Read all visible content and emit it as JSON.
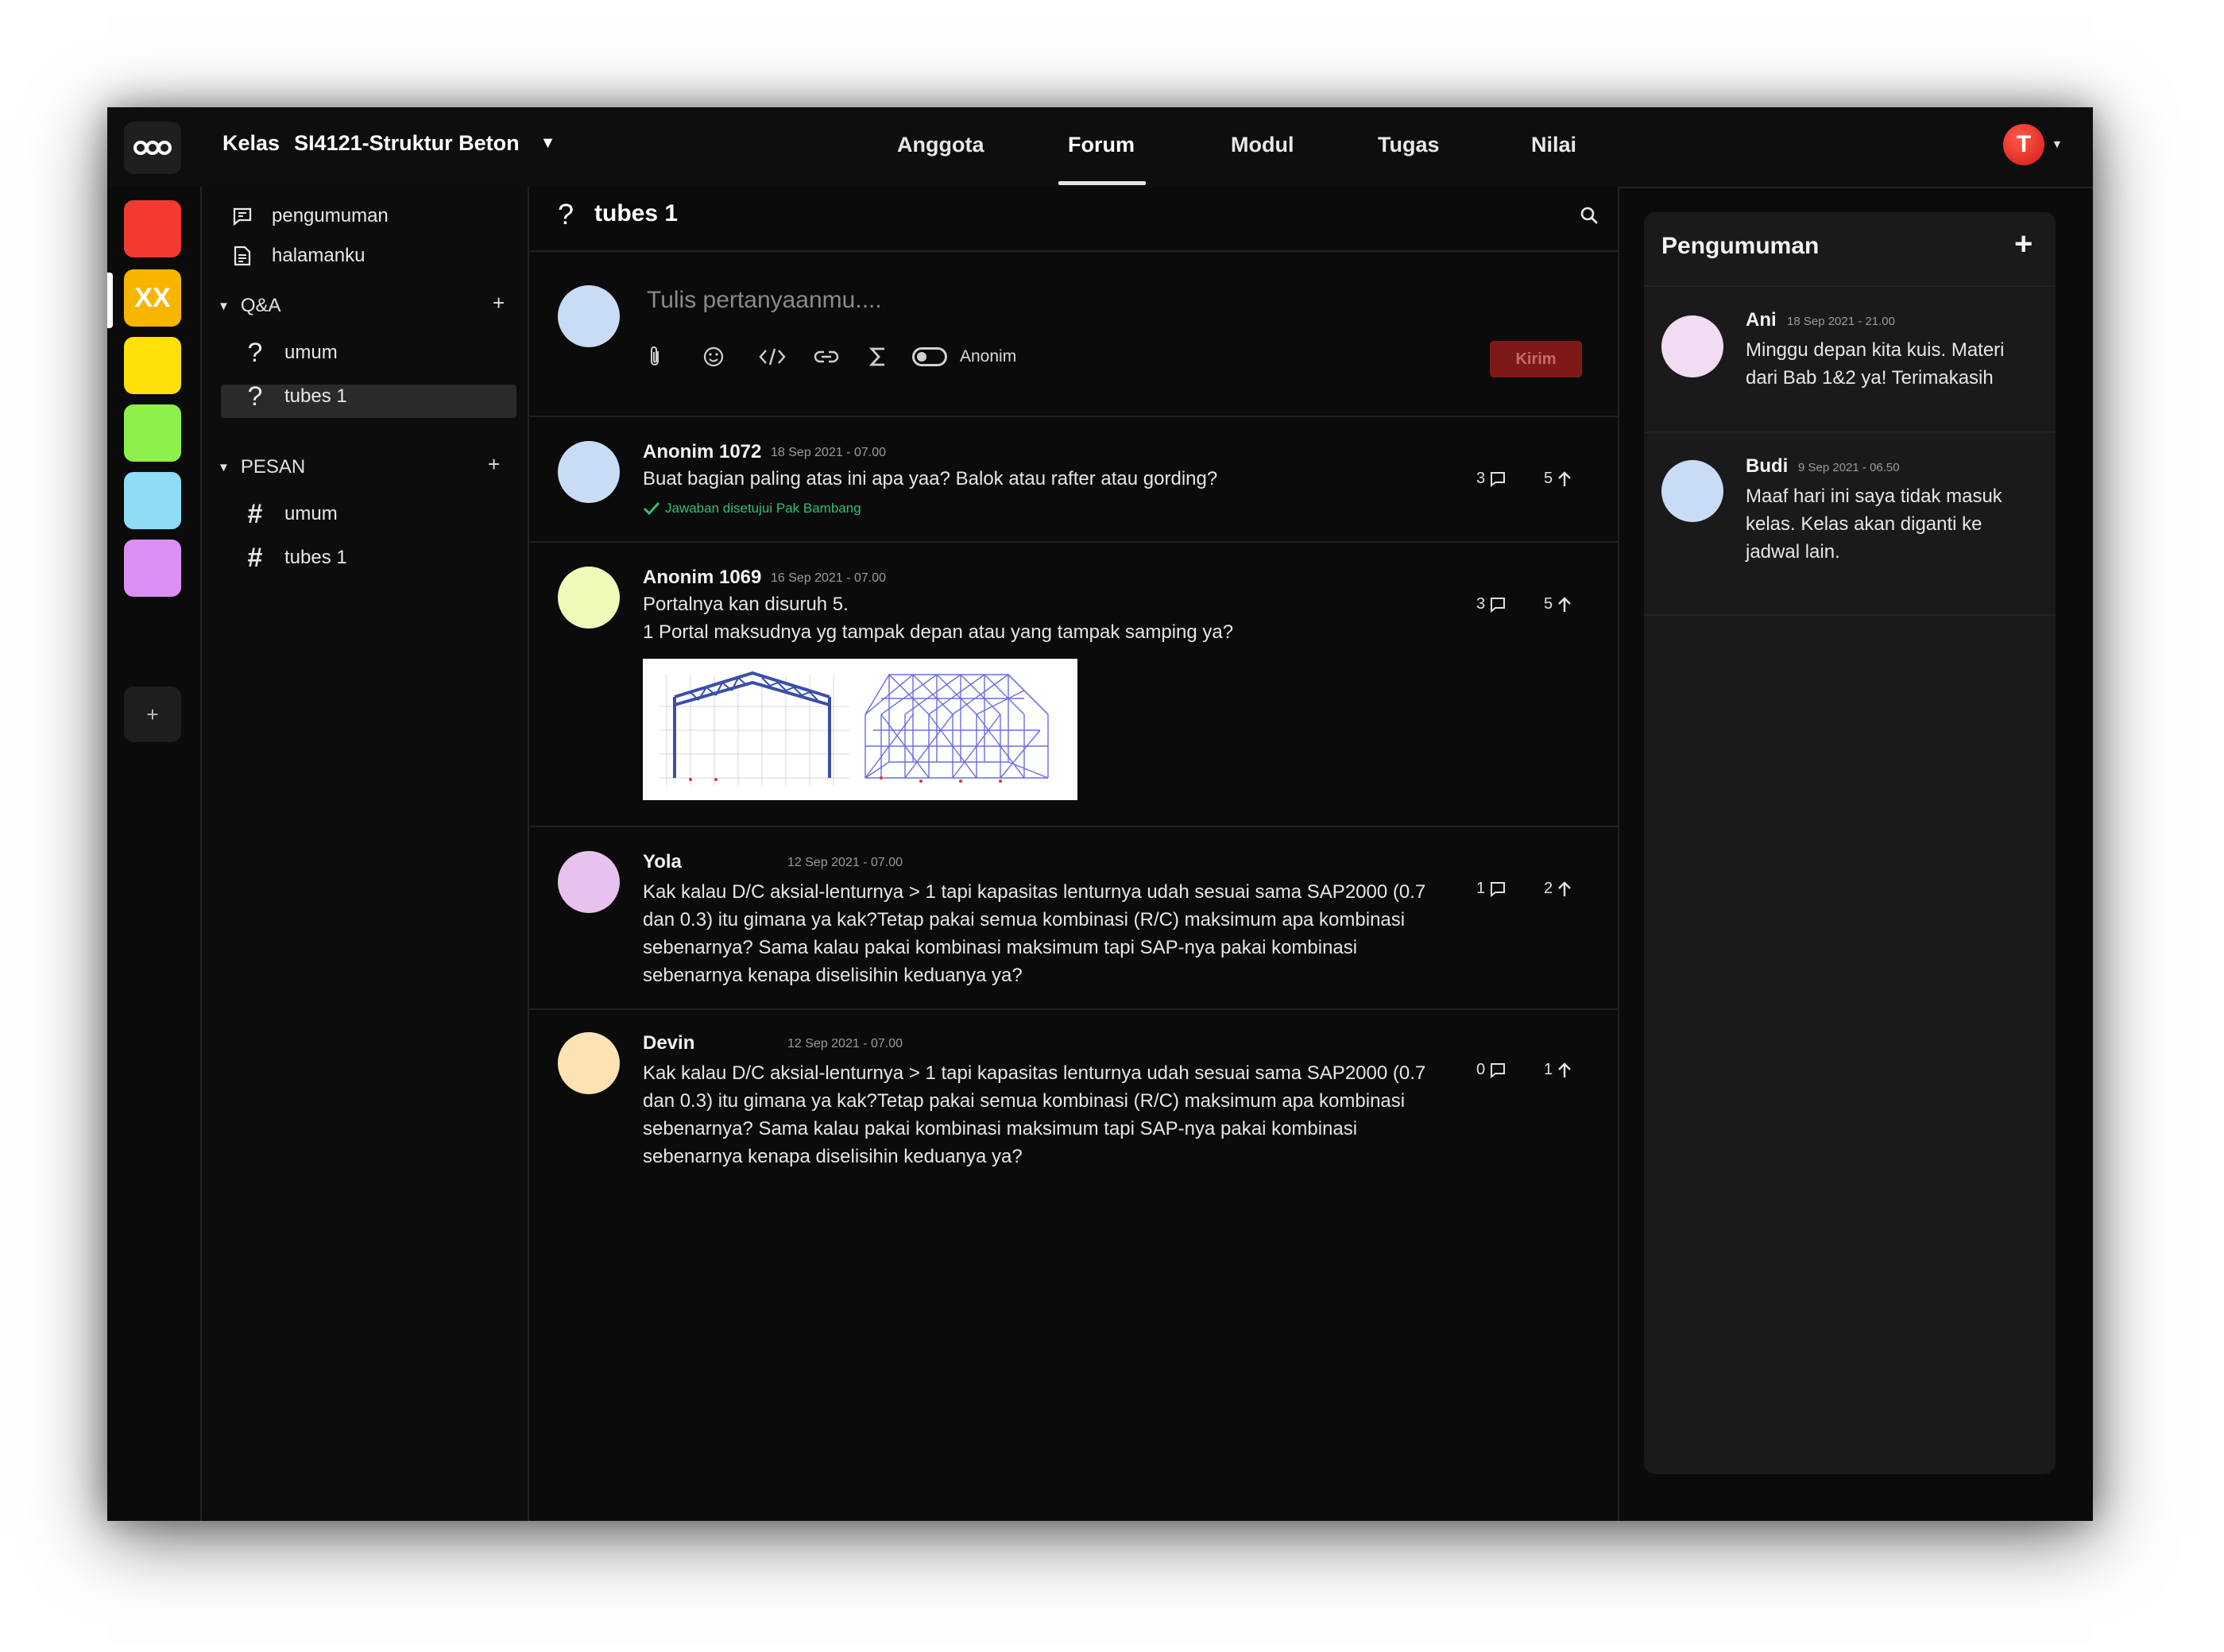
{
  "header": {
    "class_label": "Kelas",
    "class_name": "SI4121-Struktur Beton",
    "user_initial": "T",
    "nav": [
      "Anggota",
      "Forum",
      "Modul",
      "Tugas",
      "Nilai"
    ],
    "active_nav": "Forum"
  },
  "rail": {
    "tiles": [
      {
        "color": "#f23a30",
        "label": ""
      },
      {
        "color": "#f7b500",
        "label": "XX"
      },
      {
        "color": "#ffe10a",
        "label": ""
      },
      {
        "color": "#8ef04a",
        "label": ""
      },
      {
        "color": "#8fdcf7",
        "label": ""
      },
      {
        "color": "#dd90f4",
        "label": ""
      }
    ],
    "add_label": "+"
  },
  "sidebar": {
    "pengumuman": "pengumuman",
    "halamanku": "halamanku",
    "qa_section": "Q&A",
    "qa_items": [
      "umum",
      "tubes 1"
    ],
    "pesan_section": "PESAN",
    "pesan_items": [
      "umum",
      "tubes 1"
    ],
    "plus": "+"
  },
  "thread": {
    "title": "tubes 1",
    "compose_placeholder": "Tulis pertanyaanmu....",
    "anon_label": "Anonim",
    "send_label": "Kirim",
    "posts": [
      {
        "name": "Anonim 1072",
        "time": "18 Sep 2021 - 07.00",
        "body": "Buat bagian paling atas ini apa yaa? Balok atau rafter atau gording?",
        "approved": "Jawaban disetujui Pak Bambang",
        "replies": "3",
        "votes": "5",
        "avatar_color": "#c9dcf6"
      },
      {
        "name": "Anonim 1069",
        "time": "16 Sep 2021 - 07.00",
        "body": "Portalnya kan disuruh 5.\n1 Portal maksudnya yg tampak depan atau yang tampak samping ya?",
        "replies": "3",
        "votes": "5",
        "avatar_color": "#eefab8"
      },
      {
        "name": "Yola",
        "time": "12 Sep 2021 - 07.00",
        "body": "Kak kalau D/C aksial-lenturnya > 1 tapi kapasitas lenturnya udah sesuai sama SAP2000 (0.7 dan 0.3) itu gimana ya kak?Tetap pakai semua kombinasi (R/C) maksimum apa kombinasi sebenarnya? Sama kalau pakai kombinasi maksimum tapi SAP-nya pakai kombinasi sebenarnya kenapa diselisihin keduanya ya?",
        "replies": "1",
        "votes": "2",
        "avatar_color": "#e8c2ee"
      },
      {
        "name": "Devin",
        "time": "12 Sep 2021 - 07.00",
        "body": "Kak kalau D/C aksial-lenturnya > 1 tapi kapasitas lenturnya udah sesuai sama SAP2000 (0.7 dan 0.3) itu gimana ya kak?Tetap pakai semua kombinasi (R/C) maksimum apa kombinasi sebenarnya? Sama kalau pakai kombinasi maksimum tapi SAP-nya pakai kombinasi sebenarnya kenapa diselisihin keduanya ya?",
        "replies": "0",
        "votes": "1",
        "avatar_color": "#fde3b4"
      }
    ]
  },
  "announcements": {
    "title": "Pengumuman",
    "add": "+",
    "items": [
      {
        "name": "Ani",
        "time": "18 Sep 2021 - 21.00",
        "body": "Minggu depan kita kuis. Materi dari Bab 1&2 ya! Terimakasih",
        "avatar_color": "#f2dcf2"
      },
      {
        "name": "Budi",
        "time": "9 Sep 2021 - 06.50",
        "body": "Maaf hari ini saya tidak masuk kelas. Kelas akan diganti ke jadwal lain.",
        "avatar_color": "#c9dcf6"
      }
    ]
  }
}
